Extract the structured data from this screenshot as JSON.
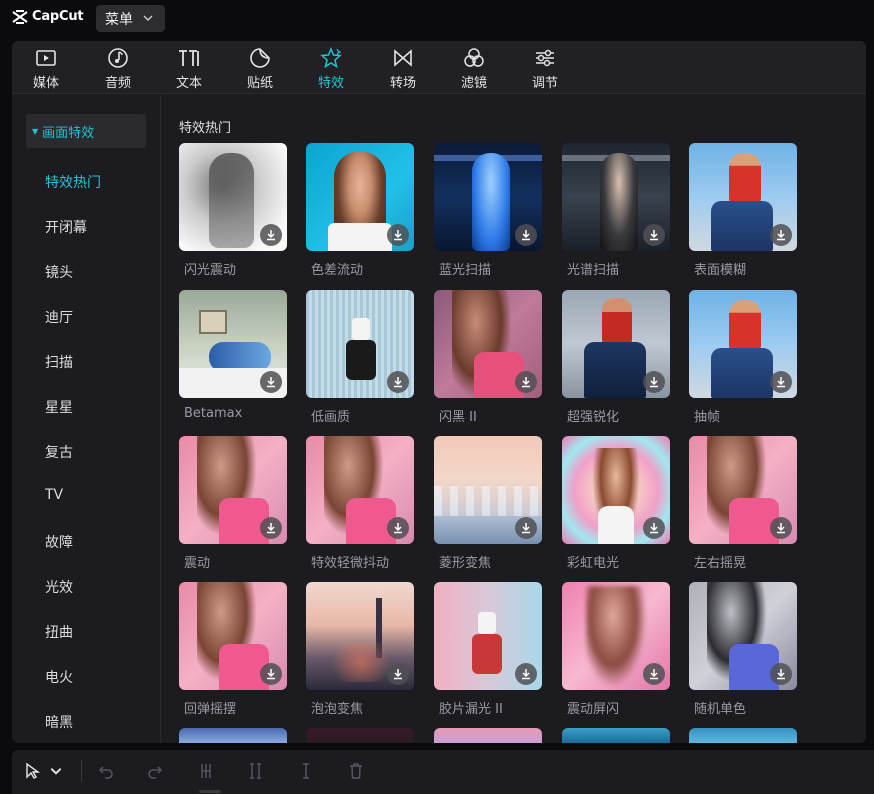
{
  "app": {
    "name": "CapCut",
    "menu_label": "菜单"
  },
  "tabs": [
    {
      "label": "媒体",
      "icon": "media-icon"
    },
    {
      "label": "音频",
      "icon": "audio-icon"
    },
    {
      "label": "文本",
      "icon": "text-icon"
    },
    {
      "label": "贴纸",
      "icon": "sticker-icon"
    },
    {
      "label": "特效",
      "icon": "effects-icon",
      "active": true
    },
    {
      "label": "转场",
      "icon": "transition-icon"
    },
    {
      "label": "滤镜",
      "icon": "filter-icon"
    },
    {
      "label": "调节",
      "icon": "adjust-icon"
    }
  ],
  "sidebar": {
    "category": "画面特效",
    "items": [
      "特效热门",
      "开闭幕",
      "镜头",
      "迪厅",
      "扫描",
      "星星",
      "复古",
      "TV",
      "故障",
      "光效",
      "扭曲",
      "电火",
      "暗黑"
    ],
    "active_index": 0
  },
  "content": {
    "section_title": "特效热门",
    "effects": [
      "闪光震动",
      "色差流动",
      "蓝光扫描",
      "光谱扫描",
      "表面模糊",
      "Betamax",
      "低画质",
      "闪黑 II",
      "超强锐化",
      "抽帧",
      "震动",
      "特效轻微抖动",
      "菱形变焦",
      "彩虹电光",
      "左右摇晃",
      "回弹摇摆",
      "泡泡变焦",
      "胶片漏光 II",
      "震动屏闪",
      "随机单色"
    ]
  },
  "colors": {
    "accent": "#21c4d4",
    "panel": "#1c1c20",
    "background": "#0b0b0d"
  },
  "toolbar": {
    "icons": [
      "select-cursor-icon",
      "dropdown-icon",
      "undo-icon",
      "redo-icon",
      "split-icon",
      "split-left-icon",
      "split-right-icon",
      "delete-icon"
    ]
  }
}
